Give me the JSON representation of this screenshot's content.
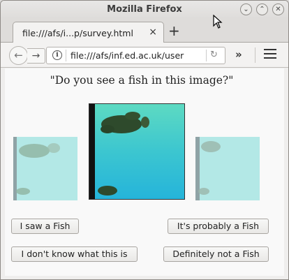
{
  "window": {
    "title": "Mozilla Firefox",
    "controls": [
      "minimize",
      "maximize",
      "close"
    ]
  },
  "tabs": [
    {
      "title": "file:///afs/i...p/survey.html",
      "close_label": "×"
    }
  ],
  "new_tab_label": "+",
  "navbar": {
    "back_label": "←",
    "forward_label": "→",
    "info_label": "i",
    "url": "file:///afs/inf.ed.ac.uk/user",
    "reload_label": "↻",
    "overflow_label": "»"
  },
  "page": {
    "question": "\"Do you see a fish in this image?\"",
    "images": [
      {
        "name": "left-preview-image"
      },
      {
        "name": "main-fish-image"
      },
      {
        "name": "right-preview-image"
      }
    ],
    "buttons": {
      "saw_fish": "I saw a Fish",
      "probably_fish": "It's probably a Fish",
      "dont_know": "I don't know what this is",
      "not_fish": "Definitely not a Fish"
    }
  },
  "colors": {
    "water_main": "#38c8cf",
    "water_pale": "#b3e8e6",
    "fish_dark": "#2e4a2c"
  }
}
